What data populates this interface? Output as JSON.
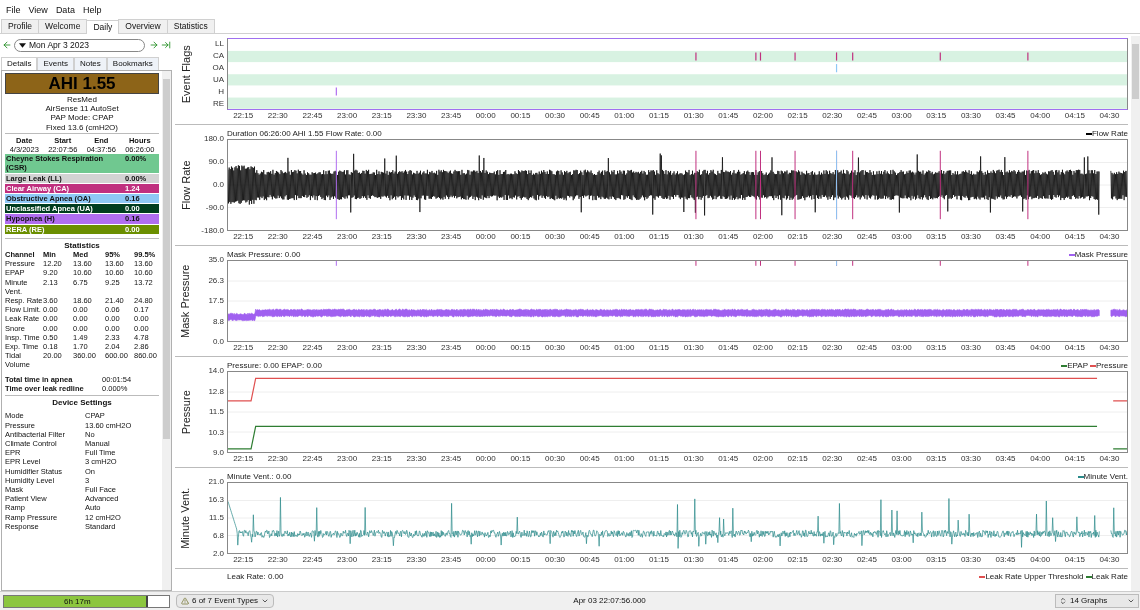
{
  "menu": [
    "File",
    "View",
    "Data",
    "Help"
  ],
  "tabs": [
    {
      "label": "Profile",
      "selected": false
    },
    {
      "label": "Welcome",
      "selected": false
    },
    {
      "label": "Daily",
      "selected": true
    },
    {
      "label": "Overview",
      "selected": false
    },
    {
      "label": "Statistics",
      "selected": false
    }
  ],
  "date_nav": {
    "date": "Mon Apr 3 2023"
  },
  "side_tabs": [
    {
      "label": "Details",
      "selected": true
    },
    {
      "label": "Events",
      "selected": false
    },
    {
      "label": "Notes",
      "selected": false
    },
    {
      "label": "Bookmarks",
      "selected": false
    }
  ],
  "details": {
    "ahi": "AHI 1.55",
    "device_lines": [
      "ResMed",
      "AirSense 11 AutoSet",
      "PAP Mode: CPAP",
      "Fixed 13.6 (cmH2O)"
    ],
    "session": {
      "columns": [
        "Date",
        "Start",
        "End",
        "Hours"
      ],
      "values": [
        "4/3/2023",
        "22:07:56",
        "04:37:56",
        "06:26:00"
      ]
    },
    "indices": [
      {
        "name": "Cheyne Stokes Respiration (CSR)",
        "value": "0.00%",
        "color": "#70c890"
      },
      {
        "name": "Large Leak (LL)",
        "value": "0.00%",
        "color": "#d3d3d3"
      },
      {
        "name": "Clear Airway (CA)",
        "value": "1.24",
        "color": "#c0307f"
      },
      {
        "name": "Obstructive Apnea (OA)",
        "value": "0.16",
        "color": "#8ec8f5"
      },
      {
        "name": "Unclassified Apnea (UA)",
        "value": "0.00",
        "color": "#003d1f"
      },
      {
        "name": "Hypopnea (H)",
        "value": "0.16",
        "color": "#b06ef0"
      },
      {
        "name": "RERA (RE)",
        "value": "0.00",
        "color": "#6b8f00"
      }
    ],
    "statistics": {
      "title": "Statistics",
      "columns": [
        "Channel",
        "Min",
        "Med",
        "95%",
        "99.5%"
      ],
      "rows": [
        [
          "Pressure",
          "12.20",
          "13.60",
          "13.60",
          "13.60"
        ],
        [
          "EPAP",
          "9.20",
          "10.60",
          "10.60",
          "10.60"
        ],
        [
          "Minute Vent.",
          "2.13",
          "6.75",
          "9.25",
          "13.72"
        ],
        [
          "Resp. Rate",
          "3.60",
          "18.60",
          "21.40",
          "24.80"
        ],
        [
          "Flow Limit.",
          "0.00",
          "0.00",
          "0.06",
          "0.17"
        ],
        [
          "Leak Rate",
          "0.00",
          "0.00",
          "0.00",
          "0.00"
        ],
        [
          "Snore",
          "0.00",
          "0.00",
          "0.00",
          "0.00"
        ],
        [
          "Insp. Time",
          "0.50",
          "1.49",
          "2.33",
          "4.78"
        ],
        [
          "Exp. Time",
          "0.18",
          "1.70",
          "2.04",
          "2.86"
        ],
        [
          "Tidal Volume",
          "20.00",
          "360.00",
          "600.00",
          "860.00"
        ]
      ]
    },
    "totals": [
      {
        "label": "Total time in apnea",
        "value": "00:01:54"
      },
      {
        "label": "Time over leak redline",
        "value": "0.000%"
      }
    ],
    "device_settings": {
      "title": "Device Settings",
      "rows": [
        {
          "label": "Mode",
          "value": "CPAP"
        },
        {
          "label": "Pressure",
          "value": "13.60 cmH2O"
        },
        {
          "label": "Antibacterial Filter",
          "value": "No"
        },
        {
          "label": "Climate Control",
          "value": "Manual"
        },
        {
          "label": "EPR",
          "value": "Full Time"
        },
        {
          "label": "EPR Level",
          "value": "3 cmH2O"
        },
        {
          "label": "Humidifier Status",
          "value": "On"
        },
        {
          "label": "Humidity Level",
          "value": "3"
        },
        {
          "label": "Mask",
          "value": "Full Face"
        },
        {
          "label": "Patient View",
          "value": "Advanced"
        },
        {
          "label": "Ramp",
          "value": "Auto"
        },
        {
          "label": "Ramp Pressure",
          "value": "12 cmH2O"
        },
        {
          "label": "Response",
          "value": "Standard"
        }
      ]
    }
  },
  "summary_bar": {
    "label": "6h 17m",
    "level": 0.87
  },
  "graphs": [
    {
      "kind": "flags",
      "title": "Event Flags",
      "rows": [
        "LL",
        "CA",
        "OA",
        "UA",
        "H",
        "RE"
      ],
      "xticks": [
        "22:15",
        "22:30",
        "22:45",
        "23:00",
        "23:15",
        "23:30",
        "23:45",
        "00:00",
        "00:15",
        "00:30",
        "00:45",
        "01:00",
        "01:15",
        "01:30",
        "01:45",
        "02:00",
        "02:15",
        "02:30",
        "02:45",
        "03:00",
        "03:15",
        "03:30",
        "03:45",
        "04:00",
        "04:15",
        "04:30"
      ]
    },
    {
      "kind": "flow",
      "title": "Flow Rate",
      "header": "Duration 06:26:00 AHI 1.55 Flow Rate: 0.00",
      "legend": [
        {
          "label": "Flow Rate",
          "color": "#000000"
        }
      ],
      "yticks": [
        "180.0",
        "90.0",
        "0.0",
        "-90.0",
        "-180.0"
      ],
      "xticks": [
        "22:15",
        "22:30",
        "22:45",
        "23:00",
        "23:15",
        "23:30",
        "23:45",
        "00:00",
        "00:15",
        "00:30",
        "00:45",
        "01:00",
        "01:15",
        "01:30",
        "01:45",
        "02:00",
        "02:15",
        "02:30",
        "02:45",
        "03:00",
        "03:15",
        "03:30",
        "03:45",
        "04:00",
        "04:15",
        "04:30"
      ]
    },
    {
      "kind": "mask",
      "title": "Mask Pressure",
      "header": "Mask Pressure: 0.00",
      "legend": [
        {
          "label": "Mask Pressure",
          "color": "#a060f0"
        }
      ],
      "yticks": [
        "35.0",
        "26.3",
        "17.5",
        "8.8",
        "0.0"
      ],
      "xticks": [
        "22:15",
        "22:30",
        "22:45",
        "23:00",
        "23:15",
        "23:30",
        "23:45",
        "00:00",
        "00:15",
        "00:30",
        "00:45",
        "01:00",
        "01:15",
        "01:30",
        "01:45",
        "02:00",
        "02:15",
        "02:30",
        "02:45",
        "03:00",
        "03:15",
        "03:30",
        "03:45",
        "04:00",
        "04:15",
        "04:30"
      ]
    },
    {
      "kind": "pressure",
      "title": "Pressure",
      "header": "Pressure: 0.00 EPAP: 0.00",
      "legend": [
        {
          "label": "EPAP",
          "color": "#2e7d32"
        },
        {
          "label": "Pressure",
          "color": "#e05050"
        }
      ],
      "yticks": [
        "14.0",
        "12.8",
        "11.5",
        "10.3",
        "9.0"
      ],
      "xticks": [
        "22:15",
        "22:30",
        "22:45",
        "23:00",
        "23:15",
        "23:30",
        "23:45",
        "00:00",
        "00:15",
        "00:30",
        "00:45",
        "01:00",
        "01:15",
        "01:30",
        "01:45",
        "02:00",
        "02:15",
        "02:30",
        "02:45",
        "03:00",
        "03:15",
        "03:30",
        "03:45",
        "04:00",
        "04:15",
        "04:30"
      ]
    },
    {
      "kind": "minvent",
      "title": "Minute Vent.",
      "header": "Minute Vent.: 0.00",
      "legend": [
        {
          "label": "Minute Vent.",
          "color": "#2a8a8a"
        }
      ],
      "yticks": [
        "21.0",
        "16.3",
        "11.5",
        "6.8",
        "2.0"
      ],
      "xticks": [
        "22:15",
        "22:30",
        "22:45",
        "23:00",
        "23:15",
        "23:30",
        "23:45",
        "00:00",
        "00:15",
        "00:30",
        "00:45",
        "01:00",
        "01:15",
        "01:30",
        "01:45",
        "02:00",
        "02:15",
        "02:30",
        "02:45",
        "03:00",
        "03:15",
        "03:30",
        "03:45",
        "04:00",
        "04:15",
        "04:30"
      ]
    },
    {
      "kind": "partial",
      "header": "Leak Rate: 0.00",
      "legend": [
        {
          "label": "Leak Rate Upper Threshold",
          "color": "#e05050"
        },
        {
          "label": "Leak Rate",
          "color": "#2e7d32"
        }
      ]
    }
  ],
  "status_bar": {
    "event_types": "6 of 7 Event Types",
    "time": "Apr 03 22:07:56.000",
    "graphs": "14 Graphs"
  }
}
